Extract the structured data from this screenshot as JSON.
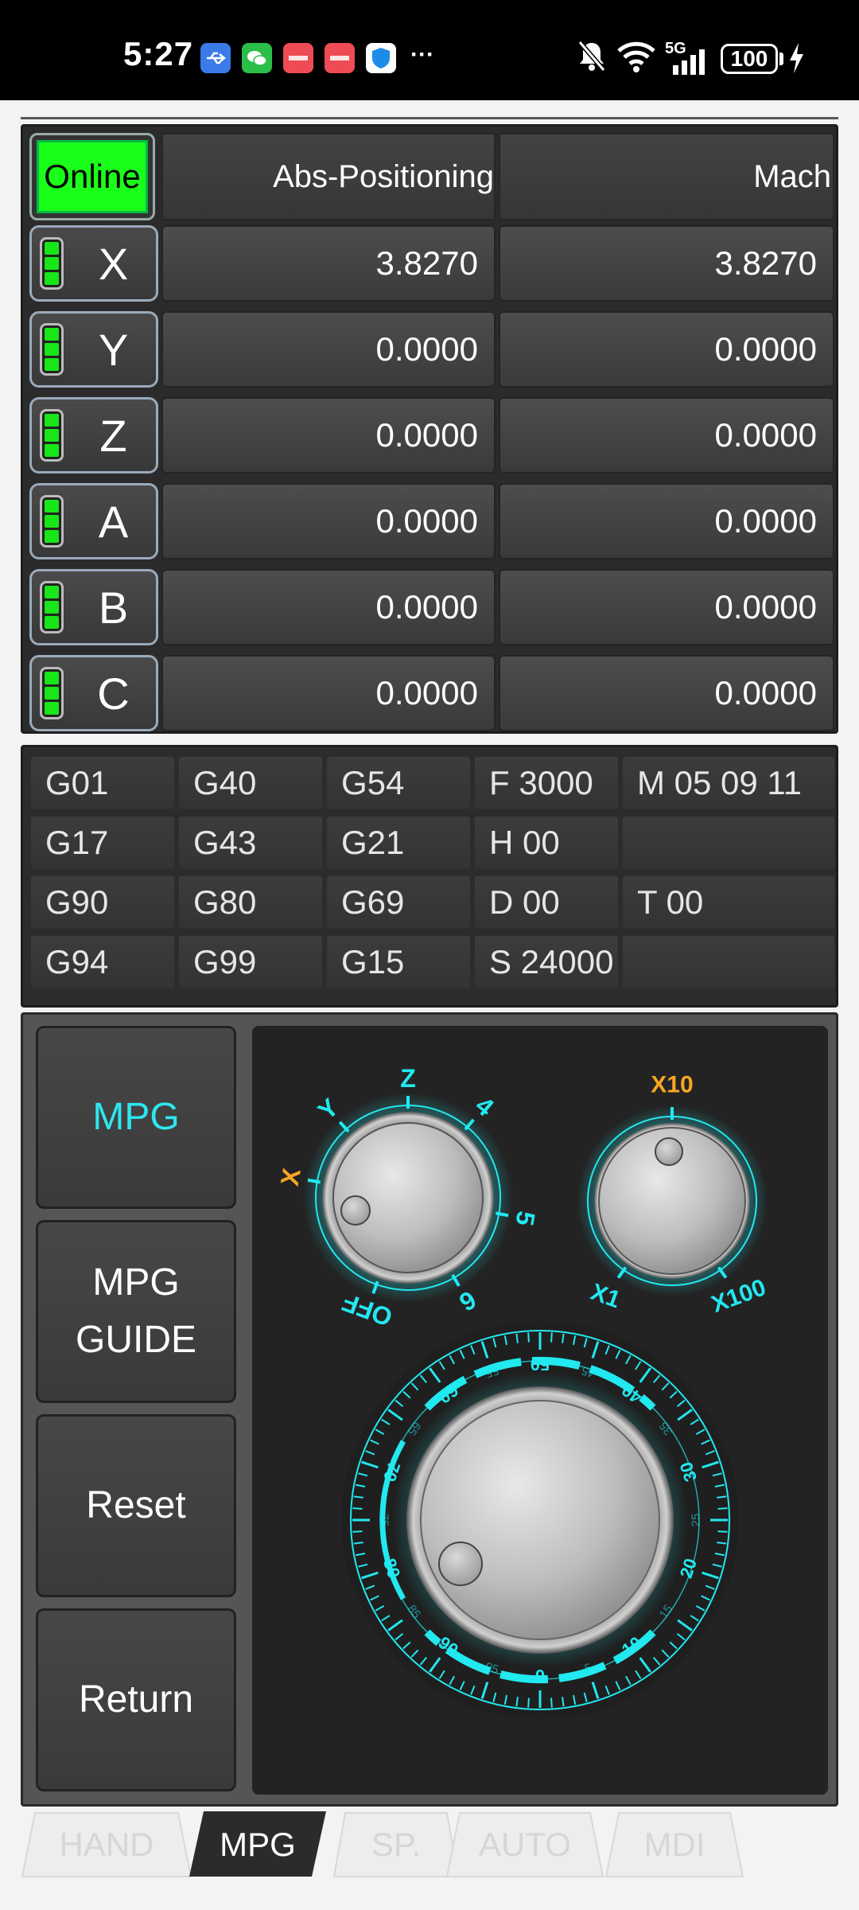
{
  "status_bar": {
    "time": "5:27",
    "network": "5G",
    "battery": "100",
    "icons": [
      "usb-icon",
      "wechat-icon",
      "huawei-icon",
      "huawei-icon",
      "shield-icon",
      "more-icon",
      "mute-bell-icon",
      "wifi-icon",
      "signal-icon",
      "charging-icon"
    ]
  },
  "positions": {
    "online_label": "Online",
    "col_abs": "Abs-Positioning",
    "col_mach": "Mach",
    "rows": [
      {
        "axis": "X",
        "abs": "3.8270",
        "mach": "3.8270"
      },
      {
        "axis": "Y",
        "abs": "0.0000",
        "mach": "0.0000"
      },
      {
        "axis": "Z",
        "abs": "0.0000",
        "mach": "0.0000"
      },
      {
        "axis": "A",
        "abs": "0.0000",
        "mach": "0.0000"
      },
      {
        "axis": "B",
        "abs": "0.0000",
        "mach": "0.0000"
      },
      {
        "axis": "C",
        "abs": "0.0000",
        "mach": "0.0000"
      }
    ]
  },
  "gcodes": {
    "rows": [
      [
        "G01",
        "G40",
        "G54",
        "F 3000",
        "M 05 09 11"
      ],
      [
        "G17",
        "G43",
        "G21",
        "H 00",
        ""
      ],
      [
        "G90",
        "G80",
        "G69",
        "D 00",
        "T 00"
      ],
      [
        "G94",
        "G99",
        "G15",
        "S 24000",
        ""
      ]
    ]
  },
  "mpg": {
    "buttons": {
      "mpg": "MPG",
      "guide_line1": "MPG",
      "guide_line2": "GUIDE",
      "reset": "Reset",
      "return": "Return"
    },
    "axis_selector": {
      "labels": [
        "OFF",
        "X",
        "Y",
        "Z",
        "4",
        "5",
        "6"
      ],
      "selected": "X"
    },
    "step_selector": {
      "labels": [
        "X1",
        "X10",
        "X100"
      ],
      "selected": "X10"
    },
    "handwheel": {
      "scale": [
        "0",
        "5",
        "10",
        "15",
        "20",
        "25",
        "30",
        "35",
        "40",
        "45",
        "50",
        "55",
        "60",
        "65",
        "70",
        "75",
        "80",
        "85",
        "90",
        "95"
      ]
    },
    "accent_color": "#22e8f0",
    "selected_color": "#f5a623"
  },
  "tabs": [
    {
      "label": "HAND",
      "active": false
    },
    {
      "label": "MPG",
      "active": true
    },
    {
      "label": "SP.",
      "active": false
    },
    {
      "label": "AUTO",
      "active": false
    },
    {
      "label": "MDI",
      "active": false
    }
  ]
}
